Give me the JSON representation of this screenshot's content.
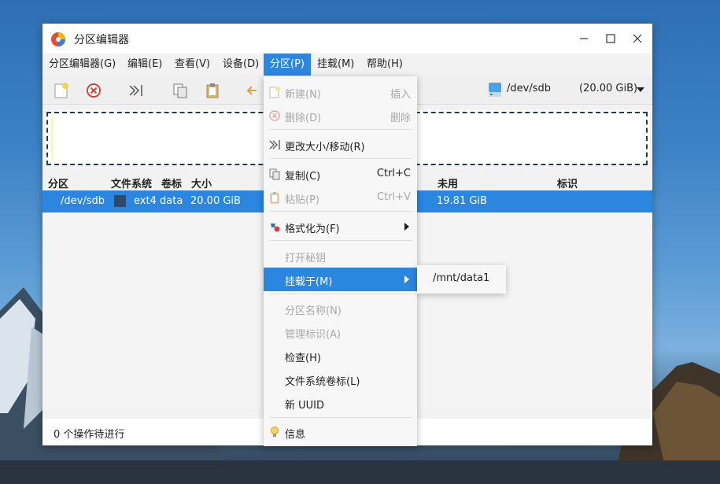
{
  "window": {
    "title": "分区编辑器"
  },
  "menubar": [
    {
      "label": "分区编辑器(G)"
    },
    {
      "label": "编辑(E)"
    },
    {
      "label": "查看(V)"
    },
    {
      "label": "设备(D)"
    },
    {
      "label": "分区(P)"
    },
    {
      "label": "挂载(M)"
    },
    {
      "label": "帮助(H)"
    }
  ],
  "toolbar": {
    "device": "/dev/sdb",
    "device_size": "(20.00 GiB)"
  },
  "list": {
    "headers": {
      "partition": "分区",
      "filesystem": "文件系统",
      "label": "卷标",
      "size": "大小",
      "unused": "未用",
      "flags": "标识"
    },
    "rows": [
      {
        "partition": "/dev/sdb",
        "filesystem": "ext4",
        "label": "data",
        "size": "20.00 GiB",
        "unused": "19.81 GiB",
        "flags": ""
      }
    ]
  },
  "status": {
    "text": "0 个操作待进行"
  },
  "partition_menu": {
    "items": [
      {
        "label": "新建(N)",
        "shortcut": "插入",
        "icon": "new-icon",
        "disabled": true
      },
      {
        "label": "删除(D)",
        "shortcut": "删除",
        "icon": "delete-icon",
        "disabled": true
      },
      {
        "label": "更改大小/移动(R)",
        "shortcut": "",
        "icon": "resize-icon",
        "disabled": false
      },
      {
        "label": "复制(C)",
        "shortcut": "Ctrl+C",
        "icon": "copy-icon",
        "disabled": false
      },
      {
        "label": "粘贴(P)",
        "shortcut": "Ctrl+V",
        "icon": "paste-icon",
        "disabled": true
      },
      {
        "label": "格式化为(F)",
        "shortcut": "",
        "icon": "format-icon",
        "disabled": false
      },
      {
        "label": "打开秘钥",
        "shortcut": "",
        "icon": "",
        "disabled": true
      },
      {
        "label": "挂载于(M)",
        "shortcut": "",
        "icon": "",
        "disabled": false,
        "highlighted": true
      },
      {
        "label": "分区名称(N)",
        "shortcut": "",
        "icon": "",
        "disabled": true
      },
      {
        "label": "管理标识(A)",
        "shortcut": "",
        "icon": "",
        "disabled": true
      },
      {
        "label": "检查(H)",
        "shortcut": "",
        "icon": "",
        "disabled": false
      },
      {
        "label": "文件系统卷标(L)",
        "shortcut": "",
        "icon": "",
        "disabled": false
      },
      {
        "label": "新 UUID",
        "shortcut": "",
        "icon": "",
        "disabled": false
      },
      {
        "label": "信息",
        "shortcut": "",
        "icon": "info-icon",
        "disabled": false
      }
    ]
  },
  "mount_submenu": {
    "items": [
      {
        "label": "/mnt/data1"
      }
    ]
  },
  "colors": {
    "accent": "#2b86e0",
    "fs_ext4": "#2e4a66"
  }
}
